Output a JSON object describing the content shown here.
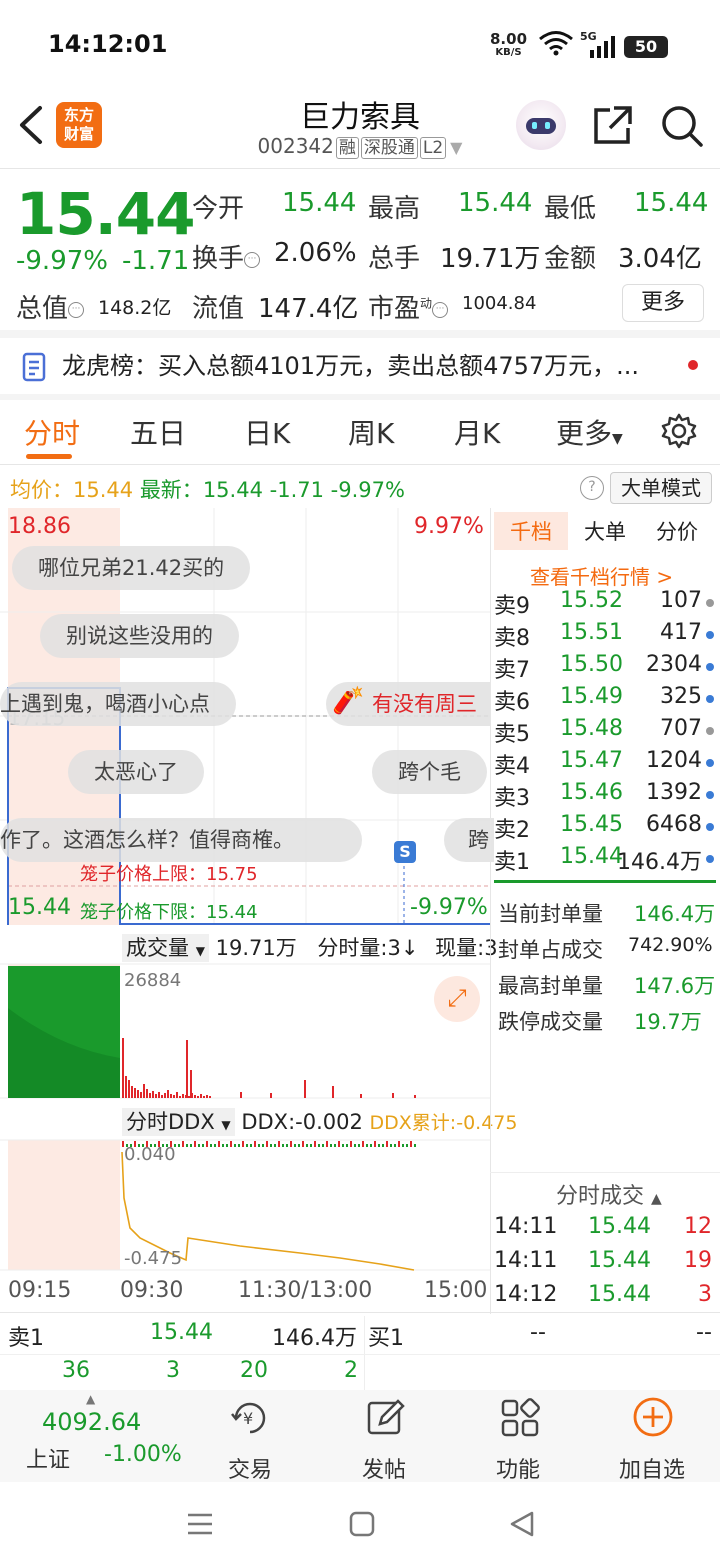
{
  "status": {
    "time": "14:12:01",
    "net_speed": "8.00",
    "net_unit": "KB/S",
    "signal": "5G",
    "battery": "50"
  },
  "header": {
    "logo_line1": "东方",
    "logo_line2": "财富",
    "title": "巨力索具",
    "code": "002342",
    "tag1": "融",
    "tag2": "深股通",
    "tag3": "L2"
  },
  "quote": {
    "price": "15.44",
    "pct": "-9.97%",
    "change": "-1.71",
    "open_label": "今开",
    "open": "15.44",
    "high_label": "最高",
    "high": "15.44",
    "low_label": "最低",
    "low": "15.44",
    "turnover_label": "换手",
    "turnover": "2.06%",
    "volume_label": "总手",
    "volume": "19.71万",
    "amount_label": "金额",
    "amount": "3.04亿",
    "mktcap_label": "总值",
    "mktcap": "148.2亿",
    "float_label": "流值",
    "float": "147.4亿",
    "pe_label": "市盈",
    "pe_sup": "动",
    "pe": "1004.84",
    "more": "更多"
  },
  "lhb": {
    "text": "龙虎榜：买入总额4101万元，卖出总额4757万元，..."
  },
  "tabs": [
    "分时",
    "五日",
    "日K",
    "周K",
    "月K",
    "更多"
  ],
  "chart_info": {
    "avg_label": "均价：",
    "avg": "15.44",
    "last_label": "最新：",
    "last": "15.44",
    "chg": "-1.71",
    "pct": "-9.97%",
    "mode": "大单模式"
  },
  "chart": {
    "y_top": "18.86",
    "y_top_pct": "9.97%",
    "y_mid": "17.15",
    "y_bottom": "15.44",
    "y_bottom_pct": "-9.97%",
    "cage_upper": "笼子价格上限：15.75",
    "cage_lower": "笼子价格下限：15.44",
    "s_badge": "S",
    "bubbles": [
      "哪位兄弟21.42买的",
      "别说这些没用的",
      "上遇到鬼，喝酒小心点",
      "有没有周三",
      "太恶心了",
      "跨个毛",
      "作了。这酒怎么样？值得商榷。",
      "跨"
    ],
    "vol_label": "成交量",
    "vol": "19.71万",
    "vol_per": "分时量:3↓",
    "vol_now": "现量:3",
    "vol_max": "26884",
    "ddx_label": "分时DDX",
    "ddx": "DDX:-0.002",
    "ddx_cum": "DDX累计:-0.475",
    "ddx_top": "0.040",
    "ddx_bottom": "-0.475",
    "times": [
      "09:15",
      "09:30",
      "11:30/13:00",
      "15:00"
    ]
  },
  "orderbook": {
    "tabs": [
      "千档",
      "大单",
      "分价"
    ],
    "view_link": "查看千档行情 >",
    "rows": [
      {
        "label": "卖9",
        "price": "15.52",
        "vol": "107",
        "dot": "gray"
      },
      {
        "label": "卖8",
        "price": "15.51",
        "vol": "417",
        "dot": "blue"
      },
      {
        "label": "卖7",
        "price": "15.50",
        "vol": "2304",
        "dot": "blue"
      },
      {
        "label": "卖6",
        "price": "15.49",
        "vol": "325",
        "dot": "blue"
      },
      {
        "label": "卖5",
        "price": "15.48",
        "vol": "707",
        "dot": "gray"
      },
      {
        "label": "卖4",
        "price": "15.47",
        "vol": "1204",
        "dot": "blue"
      },
      {
        "label": "卖3",
        "price": "15.46",
        "vol": "1392",
        "dot": "blue"
      },
      {
        "label": "卖2",
        "price": "15.45",
        "vol": "6468",
        "dot": "blue"
      },
      {
        "label": "卖1",
        "price": "15.44",
        "vol": "146.4万",
        "dot": "blue"
      }
    ],
    "seal": [
      {
        "label": "当前封单量",
        "value": "146.4万"
      },
      {
        "label": "封单占成交",
        "value": "742.90%"
      },
      {
        "label": "最高封单量",
        "value": "147.6万"
      },
      {
        "label": "跌停成交量",
        "value": "19.7万"
      }
    ]
  },
  "trades": {
    "title": "分时成交",
    "rows": [
      {
        "time": "14:11",
        "price": "15.44",
        "vol": "12"
      },
      {
        "time": "14:11",
        "price": "15.44",
        "vol": "19"
      },
      {
        "time": "14:12",
        "price": "15.44",
        "vol": "3"
      }
    ]
  },
  "bottom": {
    "sell1_label": "卖1",
    "sell1_price": "15.44",
    "sell1_vol": "146.4万",
    "buy1_label": "买1",
    "buy1_price": "--",
    "buy1_vol": "--",
    "n1": "36",
    "n2": "3",
    "n3": "20",
    "n4": "2"
  },
  "nav": {
    "index_value": "4092.64",
    "index_name": "上证",
    "index_pct": "-1.00%",
    "trade": "交易",
    "post": "发帖",
    "func": "功能",
    "add": "加自选"
  },
  "colors": {
    "up": "#e0262a",
    "down": "#1a9a2c",
    "accent": "#f26d13",
    "avg_line": "#e6a21a"
  }
}
